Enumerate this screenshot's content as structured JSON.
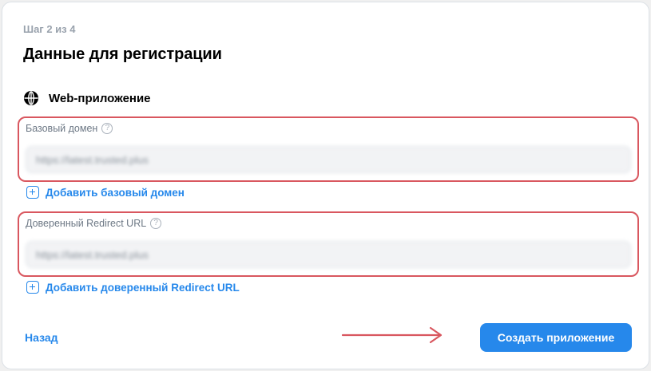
{
  "header": {
    "step_label": "Шаг 2 из 4",
    "title": "Данные для регистрации"
  },
  "platform": {
    "icon": "globe-icon",
    "label": "Web-приложение"
  },
  "fields": {
    "base_domain": {
      "label": "Базовый домен",
      "help_icon": "?",
      "value": "https://latest.trusted.plus"
    },
    "redirect_url": {
      "label": "Доверенный Redirect URL",
      "help_icon": "?",
      "value": "https://latest.trusted.plus"
    }
  },
  "links": {
    "add_base_domain": "Добавить базовый домен",
    "add_redirect_url": "Добавить доверенный Redirect URL"
  },
  "footer": {
    "back_label": "Назад",
    "create_label": "Создать приложение"
  },
  "colors": {
    "accent": "#2688eb",
    "highlight_border": "#d9575f",
    "annotation_arrow": "#d9575f"
  }
}
